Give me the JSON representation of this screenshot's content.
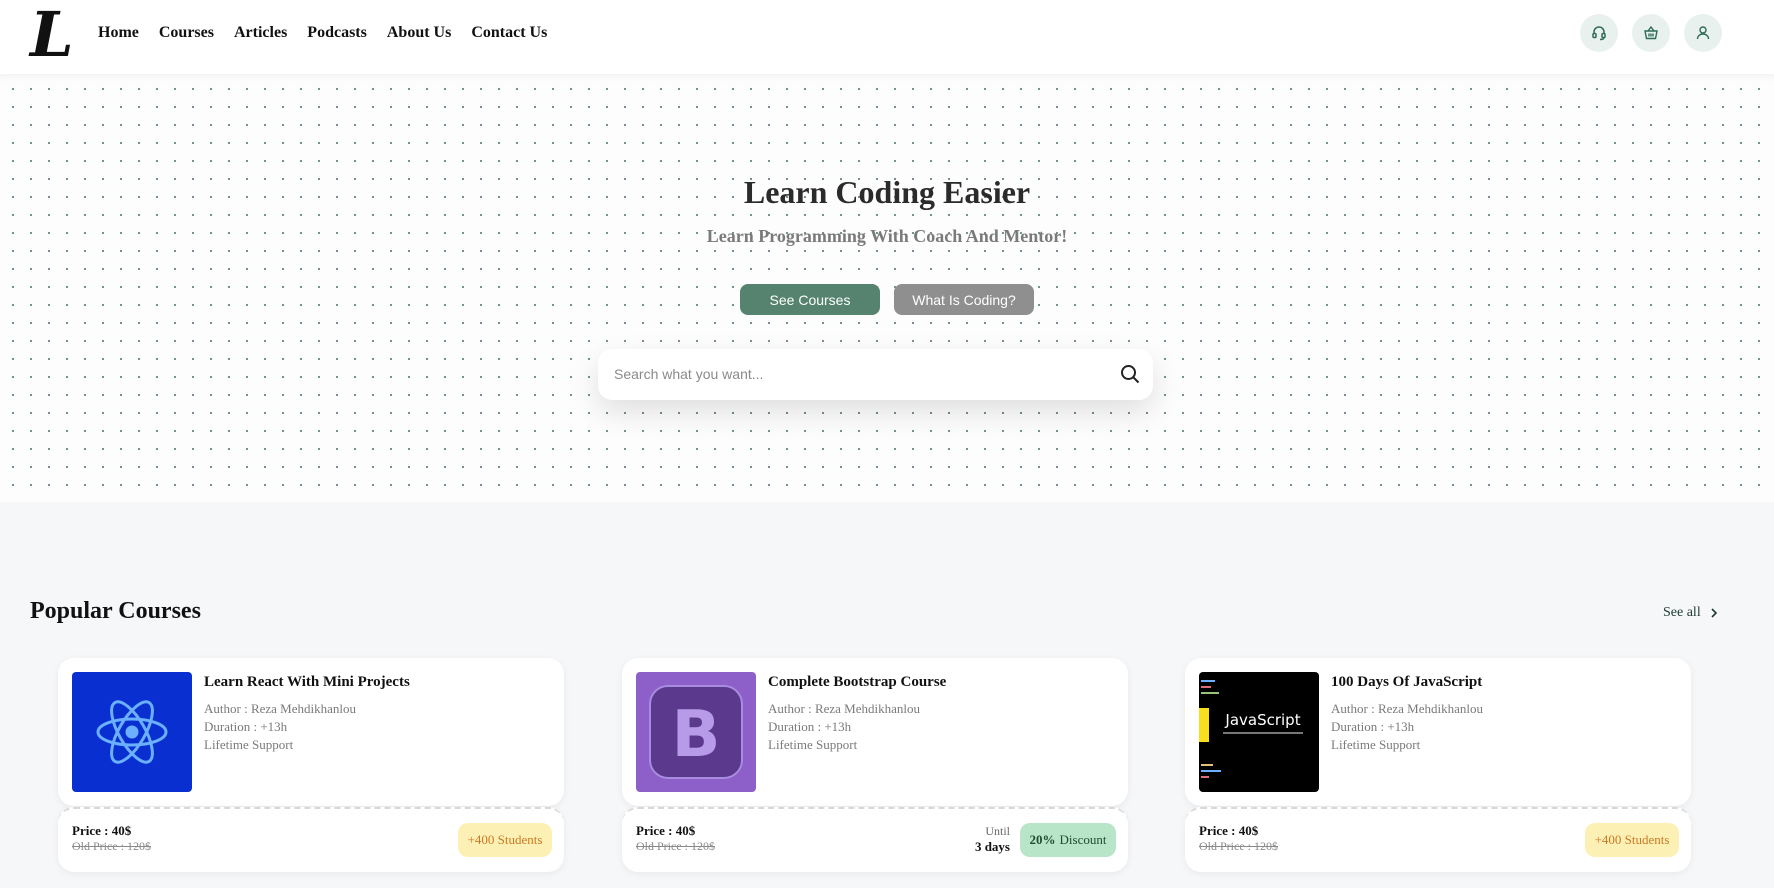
{
  "nav": {
    "logo_letter": "L",
    "links": [
      "Home",
      "Courses",
      "Articles",
      "Podcasts",
      "About Us",
      "Contact Us"
    ],
    "icons": [
      "headset-icon",
      "basket-icon",
      "user-icon"
    ]
  },
  "hero": {
    "title": "Learn Coding Easier",
    "subtitle": "Learn Programming With Coach And Mentor!",
    "primary_button": "See Courses",
    "secondary_button": "What Is Coding?",
    "search_placeholder": "Search what you want..."
  },
  "section": {
    "title": "Popular Courses",
    "see_all": "See all"
  },
  "courses": [
    {
      "title": "Learn React With Mini Projects",
      "author": "Author : Reza Mehdikhanlou",
      "duration": "Duration : +13h",
      "support": "Lifetime Support",
      "price": "Price : 40$",
      "old_price": "Old Price : 120$",
      "badge": "+400 Students",
      "thumb_icon": "react-icon",
      "thumb_color": "#0a2fd1"
    },
    {
      "title": "Complete Bootstrap Course",
      "author": "Author : Reza Mehdikhanlou",
      "duration": "Duration : +13h",
      "support": "Lifetime Support",
      "price": "Price : 40$",
      "old_price": "Old Price : 120$",
      "until_label": "Until",
      "until_value": "3 days",
      "discount_value": "20%",
      "discount_label": "Discount",
      "thumb_icon": "bootstrap-icon",
      "thumb_color": "#8c5fc9"
    },
    {
      "title": "100 Days Of JavaScript",
      "author": "Author : Reza Mehdikhanlou",
      "duration": "Duration : +13h",
      "support": "Lifetime Support",
      "price": "Price : 40$",
      "old_price": "Old Price : 120$",
      "badge": "+400 Students",
      "thumb_icon": "javascript-icon",
      "thumb_text": "JavaScript",
      "thumb_color": "#000000"
    }
  ],
  "colors": {
    "accent_green": "#558370",
    "gray_button": "#8f8f8f",
    "students_badge_bg": "#fdf0b5",
    "discount_badge_bg": "#b8e4c7"
  }
}
